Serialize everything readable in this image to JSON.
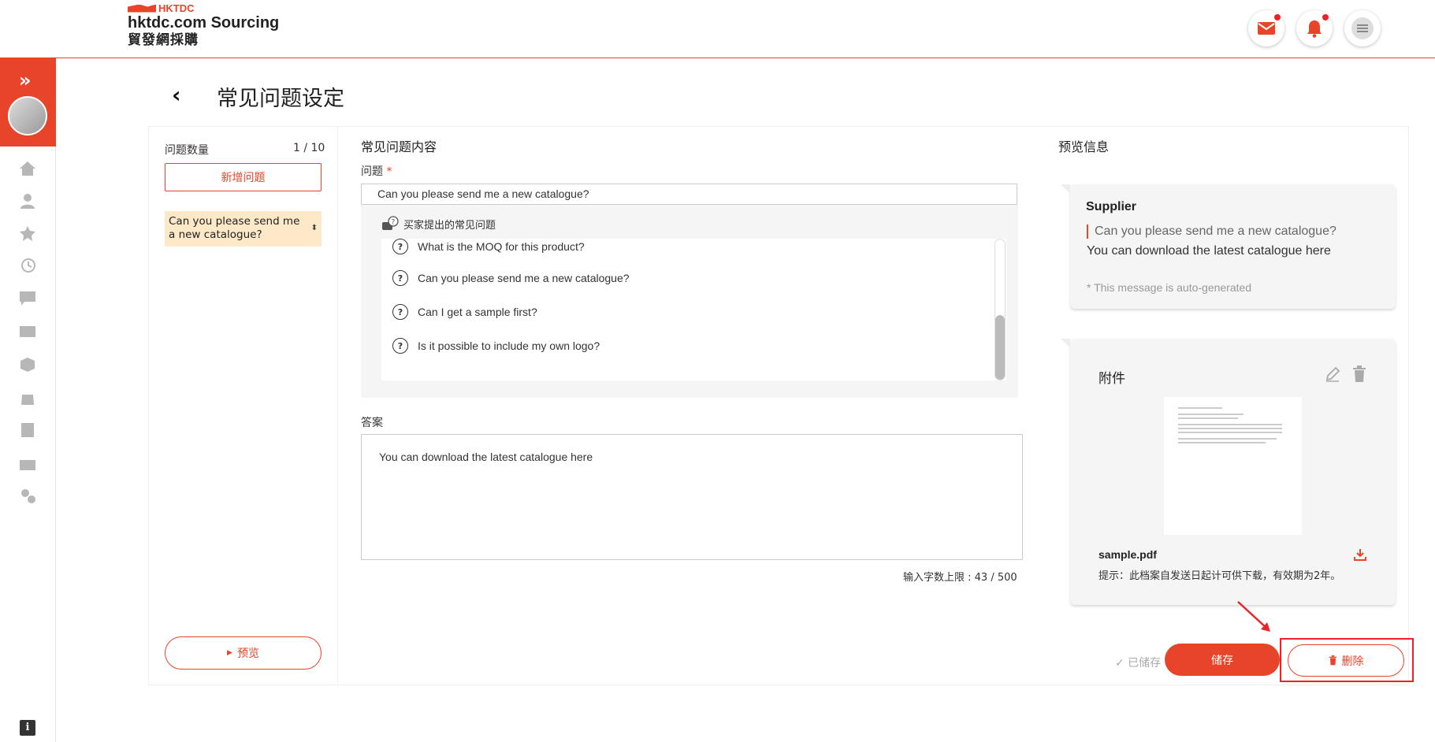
{
  "header": {
    "logo_mark": "HKTDC",
    "logo_en": "hktdc.com Sourcing",
    "logo_zh": "貿發網採購",
    "icons": [
      "mail-icon",
      "bell-icon",
      "menu-icon"
    ],
    "accent_color": "#e8442a"
  },
  "page": {
    "title": "常见问题设定"
  },
  "left_panel": {
    "count_label": "问题数量",
    "count_value": "1 / 10",
    "add_button": "新增问题",
    "questions": [
      "Can you please send me a new catalogue?"
    ],
    "preview_button": "预览"
  },
  "content": {
    "section_title": "常见问题内容",
    "question_label": "问题",
    "required_mark": "*",
    "question_value": "Can you please send me a new catalogue?",
    "faq_heading": "买家提出的常见问题",
    "faq_items": [
      "What is the MOQ for this product?",
      "Can you please send me a new catalogue?",
      "Can I get a sample first?",
      "Is it possible to include my own logo?"
    ],
    "answer_label": "答案",
    "answer_value": "You can download the latest catalogue here",
    "char_limit": "输入字数上限 : 43 / 500"
  },
  "preview": {
    "section_title": "预览信息",
    "supplier": "Supplier",
    "question": "Can you please send me a new catalogue?",
    "answer": "You can download the latest catalogue here",
    "note": "* This message is auto-generated",
    "attachment_title": "附件",
    "file_name": "sample.pdf",
    "hint": "提示：此档案自发送日起计可供下载，有效期为2年。"
  },
  "actions": {
    "saved": "✓ 已储存",
    "save": "储存",
    "delete": "删除"
  }
}
